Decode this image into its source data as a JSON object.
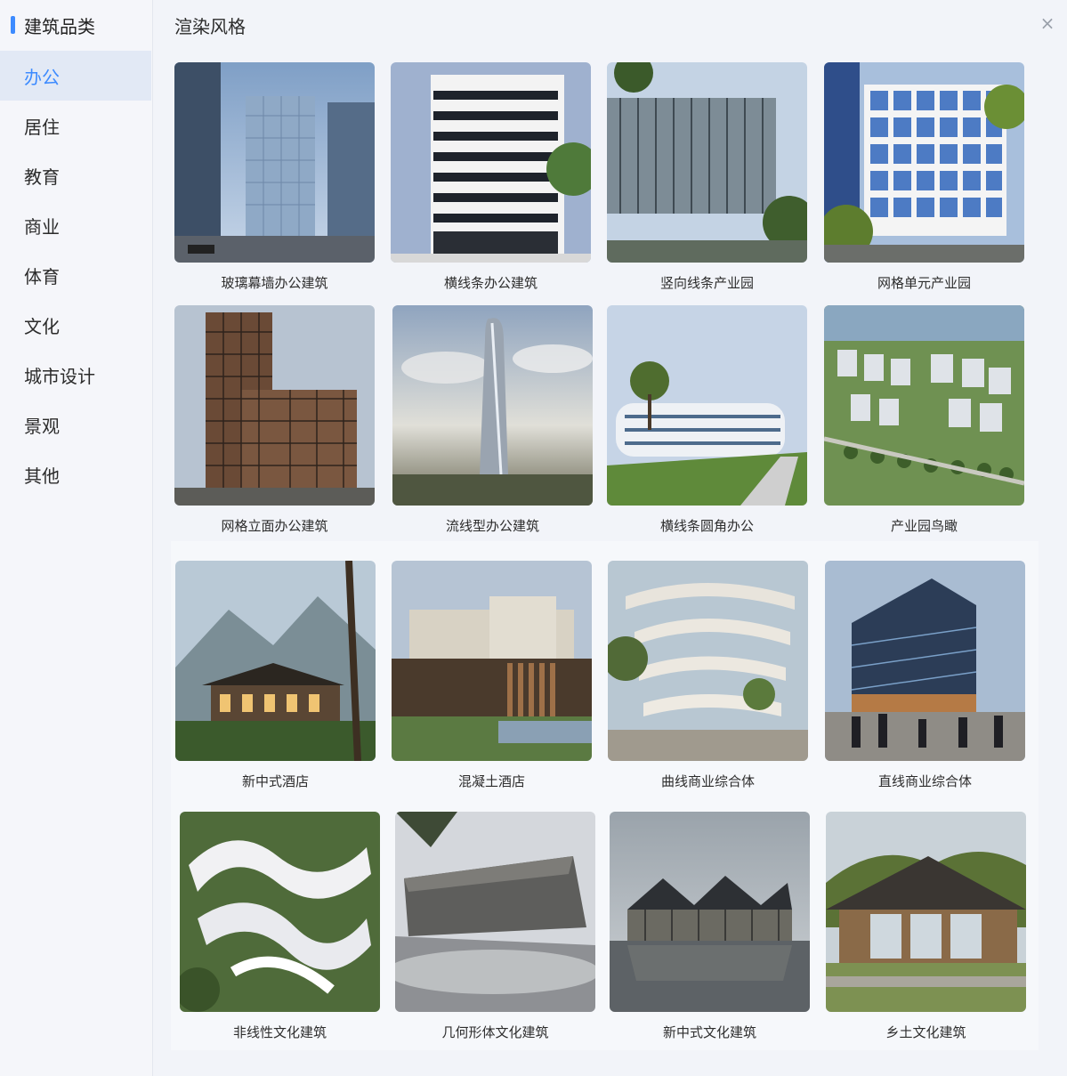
{
  "sidebar": {
    "title": "建筑品类",
    "items": [
      {
        "label": "办公",
        "active": true
      },
      {
        "label": "居住",
        "active": false
      },
      {
        "label": "教育",
        "active": false
      },
      {
        "label": "商业",
        "active": false
      },
      {
        "label": "体育",
        "active": false
      },
      {
        "label": "文化",
        "active": false
      },
      {
        "label": "城市设计",
        "active": false
      },
      {
        "label": "景观",
        "active": false
      },
      {
        "label": "其他",
        "active": false
      }
    ]
  },
  "main": {
    "title": "渲染风格",
    "close_icon": "×",
    "cards": [
      {
        "label": "玻璃幕墙办公建筑"
      },
      {
        "label": "横线条办公建筑"
      },
      {
        "label": "竖向线条产业园"
      },
      {
        "label": "网格单元产业园"
      },
      {
        "label": "网格立面办公建筑"
      },
      {
        "label": "流线型办公建筑"
      },
      {
        "label": "横线条圆角办公"
      },
      {
        "label": "产业园鸟瞰"
      },
      {
        "label": "新中式酒店"
      },
      {
        "label": "混凝土酒店"
      },
      {
        "label": "曲线商业综合体"
      },
      {
        "label": "直线商业综合体"
      },
      {
        "label": "非线性文化建筑"
      },
      {
        "label": "几何形体文化建筑"
      },
      {
        "label": "新中式文化建筑"
      },
      {
        "label": "乡土文化建筑"
      }
    ]
  },
  "colors": {
    "accent": "#3d8bff",
    "active_bg": "#e2e9f5"
  }
}
